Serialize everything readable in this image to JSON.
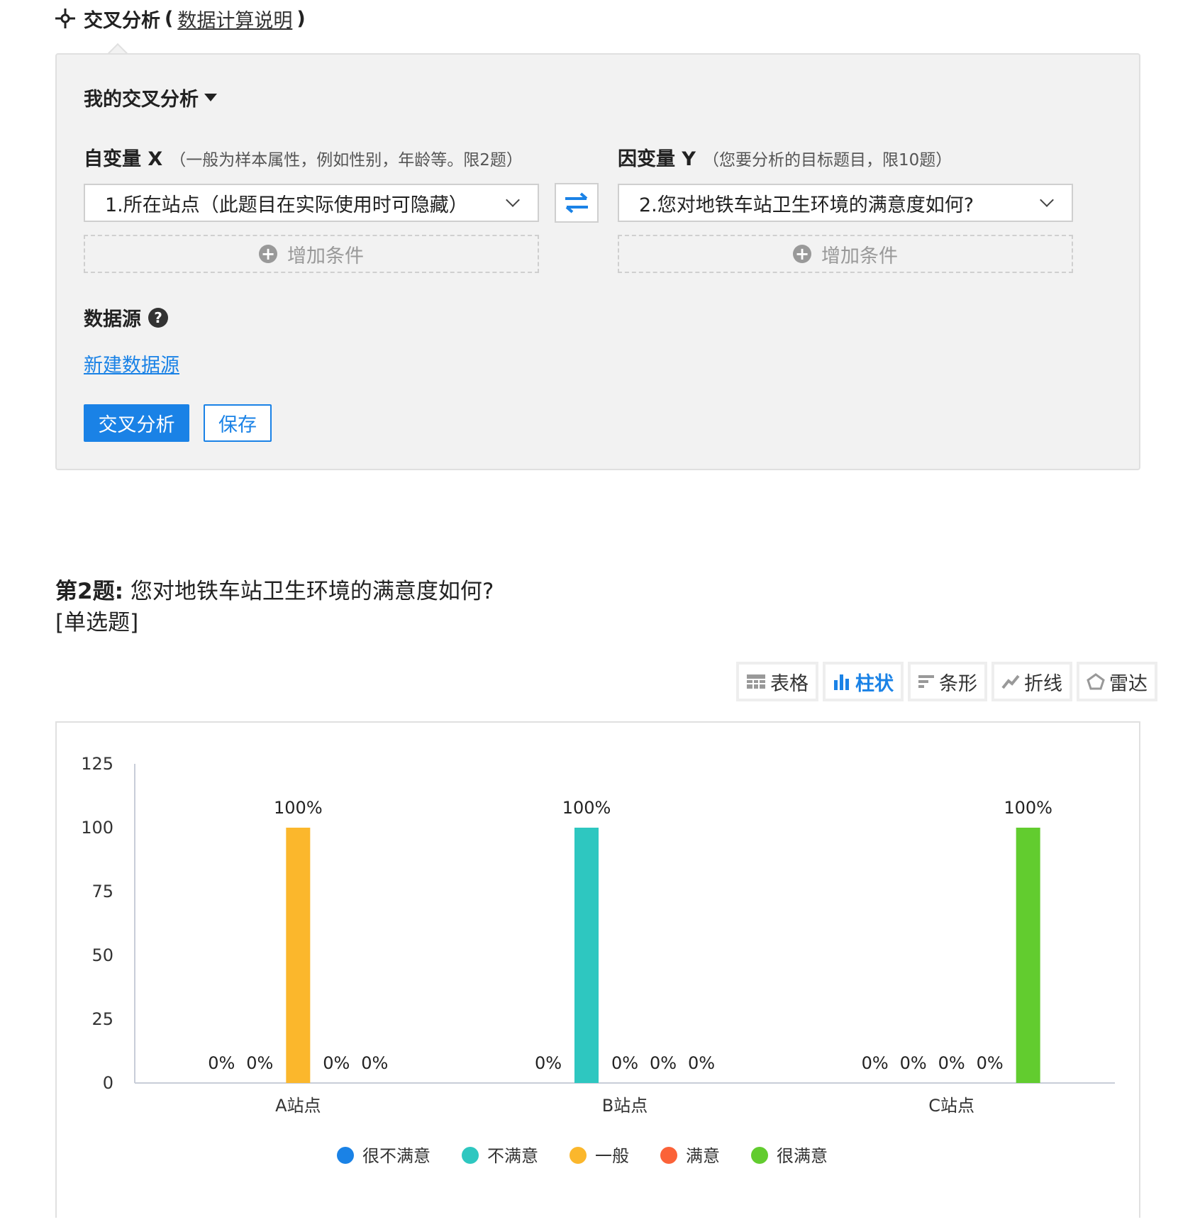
{
  "header": {
    "title": "交叉分析",
    "paren_open": "(",
    "link": "数据计算说明",
    "paren_close": ")"
  },
  "panel": {
    "my_cross": "我的交叉分析",
    "x_label": "自变量 X",
    "x_hint": "（一般为样本属性，例如性别，年龄等。限2题）",
    "y_label": "因变量 Y",
    "y_hint": "（您要分析的目标题目，限10题）",
    "x_select": "1.所在站点（此题目在实际使用时可隐藏）",
    "y_select": "2.您对地铁车站卫生环境的满意度如何?",
    "add_condition": "增加条件",
    "datasource_label": "数据源",
    "datasource_link": "新建数据源",
    "analyze_button": "交叉分析",
    "save_button": "保存"
  },
  "question": {
    "number": "第2题:",
    "text": "您对地铁车站卫生环境的满意度如何?",
    "type": "[单选题]"
  },
  "toolbar": {
    "items": [
      {
        "label": "表格",
        "icon": "table-icon",
        "active": false
      },
      {
        "label": "柱状",
        "icon": "bar-chart-icon",
        "active": true
      },
      {
        "label": "条形",
        "icon": "horizontal-bar-icon",
        "active": false
      },
      {
        "label": "折线",
        "icon": "line-chart-icon",
        "active": false
      },
      {
        "label": "雷达",
        "icon": "radar-icon",
        "active": false
      }
    ]
  },
  "colors": {
    "accent": "#1a82e6"
  },
  "chart_data": {
    "type": "bar",
    "categories": [
      "A站点",
      "B站点",
      "C站点"
    ],
    "ylim": [
      0,
      125
    ],
    "yticks": [
      0,
      25,
      50,
      75,
      100,
      125
    ],
    "legend_position": "bottom",
    "series": [
      {
        "name": "很不满意",
        "color": "#1a82e6",
        "values": [
          0,
          0,
          0
        ],
        "labels": [
          "0%",
          "0%",
          "0%"
        ]
      },
      {
        "name": "不满意",
        "color": "#2ec7c0",
        "values": [
          0,
          100,
          0
        ],
        "labels": [
          "0%",
          "100%",
          "0%"
        ]
      },
      {
        "name": "一般",
        "color": "#fbb72c",
        "values": [
          100,
          0,
          0
        ],
        "labels": [
          "100%",
          "0%",
          "0%"
        ]
      },
      {
        "name": "满意",
        "color": "#fb6238",
        "values": [
          0,
          0,
          0
        ],
        "labels": [
          "0%",
          "0%",
          "0%"
        ]
      },
      {
        "name": "很满意",
        "color": "#62cc2f",
        "values": [
          0,
          0,
          100
        ],
        "labels": [
          "0%",
          "0%",
          "100%"
        ]
      }
    ]
  }
}
